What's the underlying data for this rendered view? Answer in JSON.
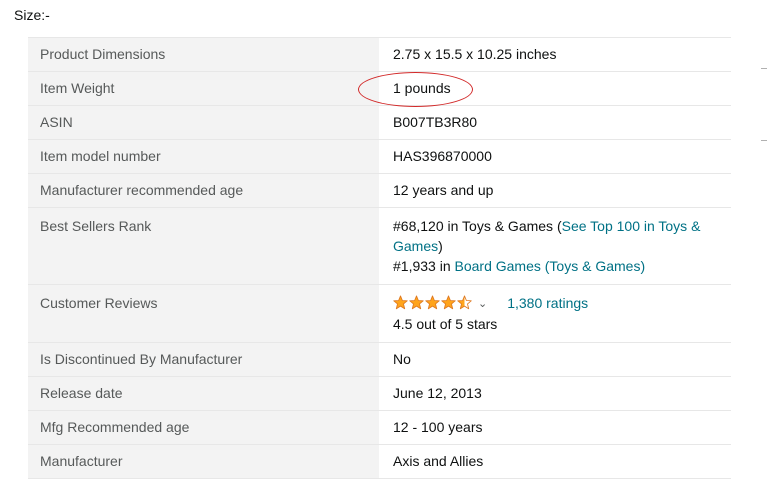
{
  "size_label": "Size:-",
  "rows": [
    {
      "label": "Product Dimensions",
      "value": "2.75 x 15.5 x 10.25 inches"
    },
    {
      "label": "Item Weight",
      "value": "1 pounds"
    },
    {
      "label": "ASIN",
      "value": "B007TB3R80"
    },
    {
      "label": "Item model number",
      "value": "HAS396870000"
    },
    {
      "label": "Manufacturer recommended age",
      "value": "12 years and up"
    },
    {
      "label": "Best Sellers Rank"
    },
    {
      "label": "Customer Reviews"
    },
    {
      "label": "Is Discontinued By Manufacturer",
      "value": "No"
    },
    {
      "label": "Release date",
      "value": "June 12, 2013"
    },
    {
      "label": "Mfg Recommended age",
      "value": "12 - 100 years"
    },
    {
      "label": "Manufacturer",
      "value": "Axis and Allies"
    }
  ],
  "best_sellers_rank": {
    "rank1": "#68,120 in Toys & Games (",
    "rank1_link": "See Top 100 in Toys & Games",
    "rank1_close": ")",
    "rank2": "#1,933 in ",
    "rank2_link": "Board Games (Toys & Games)"
  },
  "reviews": {
    "rating": 4.5,
    "star_color": "#ffa41c",
    "ratings_count": "1,380 ratings",
    "rating_text": "4.5 out of 5 stars",
    "chevron_icon": "chevron-down-icon"
  },
  "highlight_color": "#d22a2a"
}
